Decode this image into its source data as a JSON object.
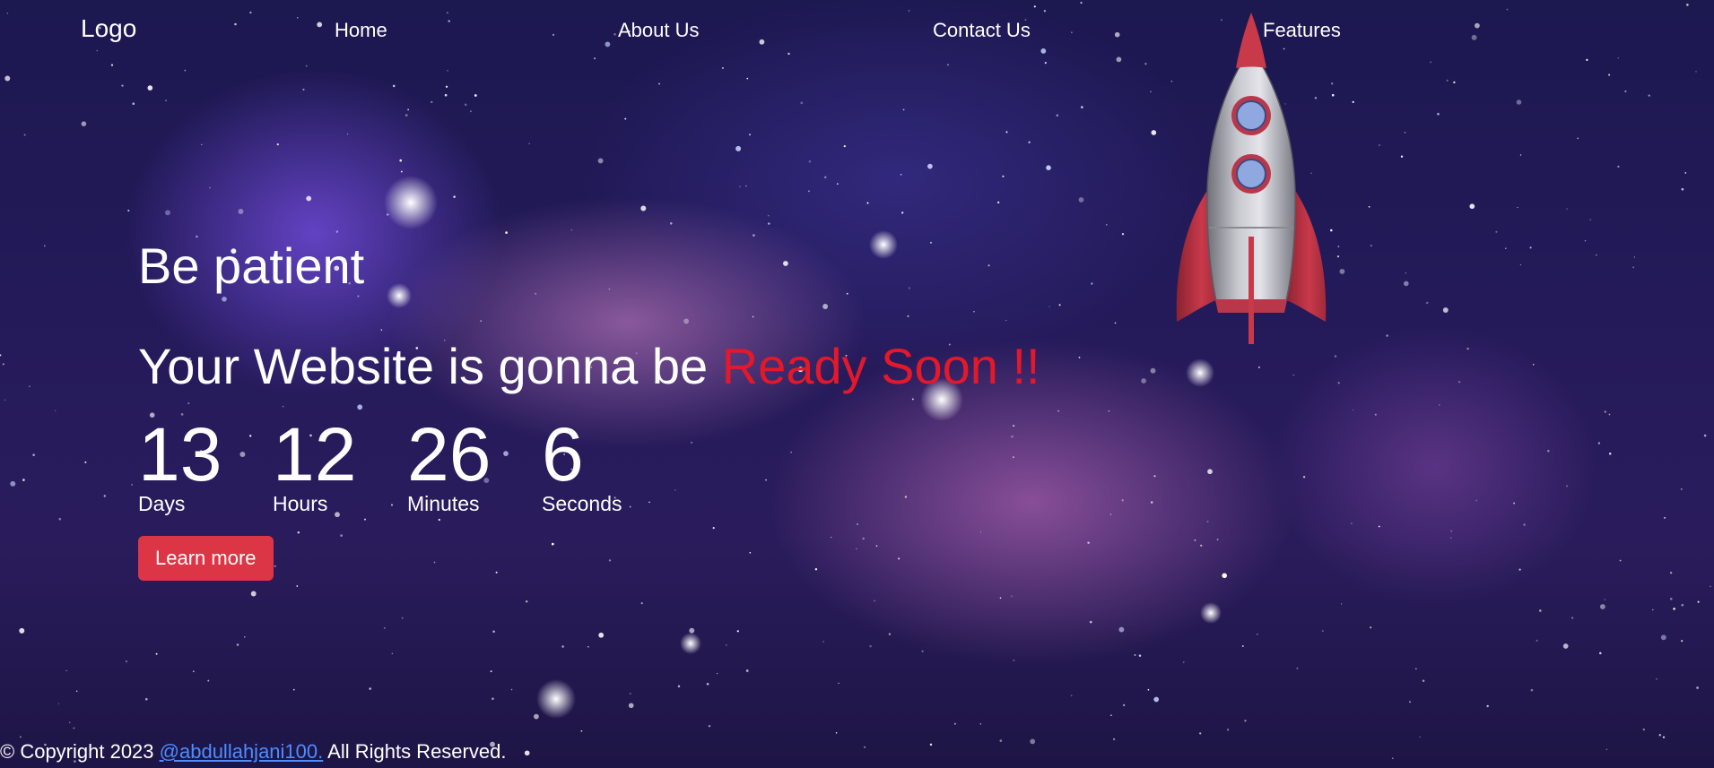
{
  "nav": {
    "logo": "Logo",
    "links": [
      "Home",
      "About Us",
      "Contact Us",
      "Features"
    ]
  },
  "hero": {
    "line1": "Be patient",
    "line2_prefix": "Your Website is gonna be ",
    "line2_highlight": "Ready Soon !!",
    "highlight_color": "#e3182b"
  },
  "countdown": [
    {
      "value": "13",
      "label": "Days"
    },
    {
      "value": "12",
      "label": "Hours"
    },
    {
      "value": "26",
      "label": "Minutes"
    },
    {
      "value": "6",
      "label": "Seconds"
    }
  ],
  "cta": {
    "label": "Learn more",
    "color": "#dc3545"
  },
  "footer": {
    "prefix": "© Copyright 2023 ",
    "link": "@abdullahjani100.",
    "suffix": " All Rights Reserved."
  },
  "icons": {
    "rocket": "rocket-icon"
  }
}
